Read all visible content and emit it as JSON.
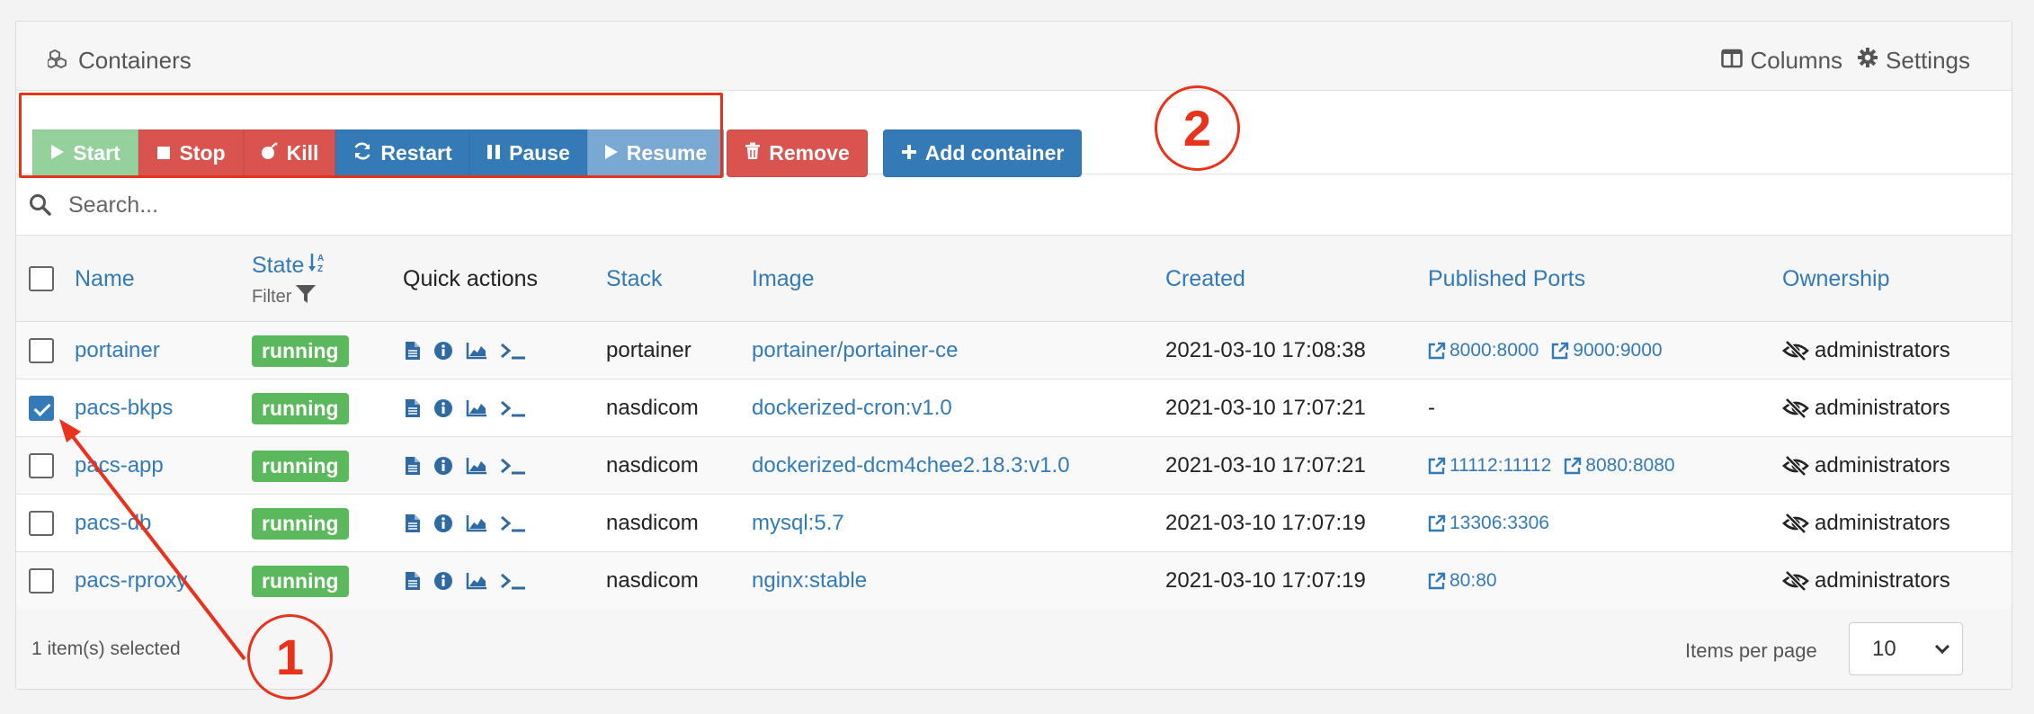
{
  "header": {
    "title": "Containers",
    "columns_label": "Columns",
    "settings_label": "Settings"
  },
  "toolbar": {
    "start": "Start",
    "stop": "Stop",
    "kill": "Kill",
    "restart": "Restart",
    "pause": "Pause",
    "resume": "Resume",
    "remove": "Remove",
    "add_container": "Add container"
  },
  "search": {
    "placeholder": "Search..."
  },
  "table": {
    "headers": {
      "name": "Name",
      "state": "State",
      "state_filter": "Filter",
      "quick_actions": "Quick actions",
      "stack": "Stack",
      "image": "Image",
      "created": "Created",
      "ports": "Published Ports",
      "ownership": "Ownership"
    },
    "rows": [
      {
        "name": "portainer",
        "state": "running",
        "stack": "portainer",
        "image": "portainer/portainer-ce",
        "created": "2021-03-10 17:08:38",
        "ports": [
          "8000:8000",
          "9000:9000"
        ],
        "ownership": "administrators",
        "checked": false
      },
      {
        "name": "pacs-bkps",
        "state": "running",
        "stack": "nasdicom",
        "image": "dockerized-cron:v1.0",
        "created": "2021-03-10 17:07:21",
        "ports_text": "-",
        "ownership": "administrators",
        "checked": true
      },
      {
        "name": "pacs-app",
        "state": "running",
        "stack": "nasdicom",
        "image": "dockerized-dcm4chee2.18.3:v1.0",
        "created": "2021-03-10 17:07:21",
        "ports": [
          "11112:11112",
          "8080:8080"
        ],
        "ownership": "administrators",
        "checked": false
      },
      {
        "name": "pacs-db",
        "state": "running",
        "stack": "nasdicom",
        "image": "mysql:5.7",
        "created": "2021-03-10 17:07:19",
        "ports": [
          "13306:3306"
        ],
        "ownership": "administrators",
        "checked": false
      },
      {
        "name": "pacs-rproxy",
        "state": "running",
        "stack": "nasdicom",
        "image": "nginx:stable",
        "created": "2021-03-10 17:07:19",
        "ports": [
          "80:80"
        ],
        "ownership": "administrators",
        "checked": false
      }
    ]
  },
  "footer": {
    "selected_text": "1 item(s) selected",
    "items_per_page_label": "Items per page",
    "items_per_page_value": "10"
  },
  "annotations": {
    "one": "1",
    "two": "2"
  },
  "colors": {
    "primary": "#337ab7",
    "danger": "#d9534f",
    "success": "#5cb85c",
    "annotation": "#e8321c"
  }
}
